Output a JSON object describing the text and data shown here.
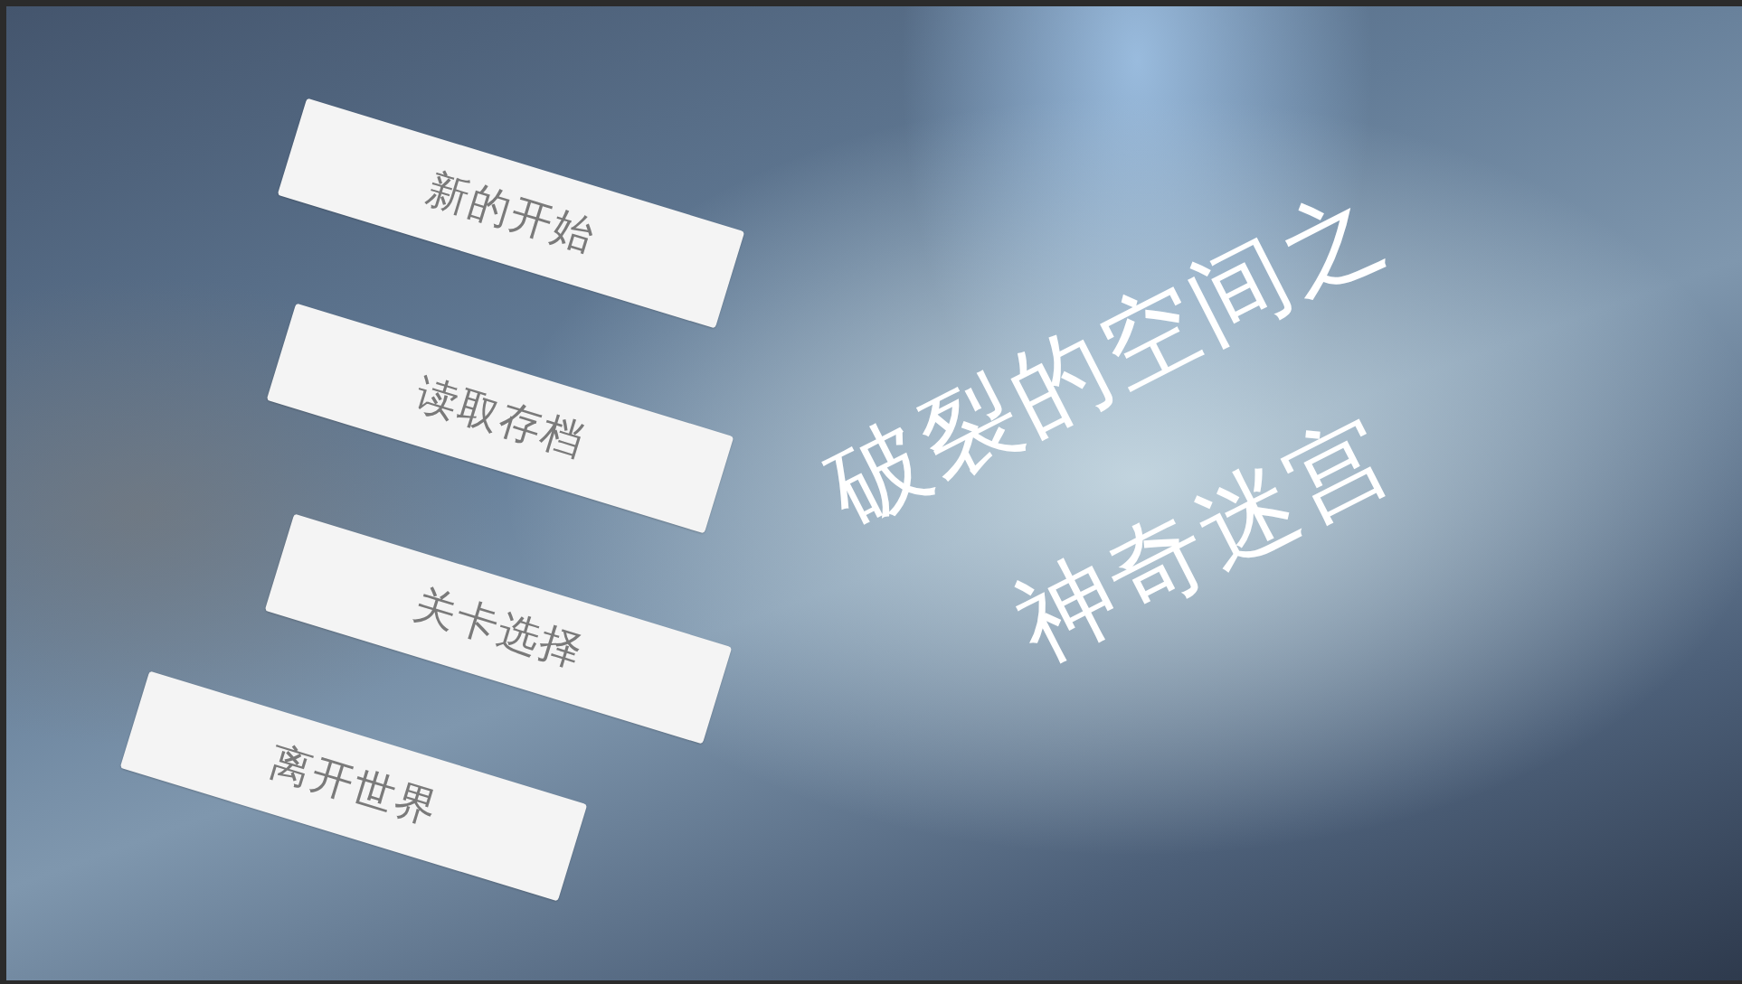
{
  "title_lines": [
    "破裂的空间之",
    "神奇迷宫"
  ],
  "menu": [
    {
      "label": "新的开始"
    },
    {
      "label": "读取存档"
    },
    {
      "label": "关卡选择"
    },
    {
      "label": "离开世界"
    }
  ]
}
